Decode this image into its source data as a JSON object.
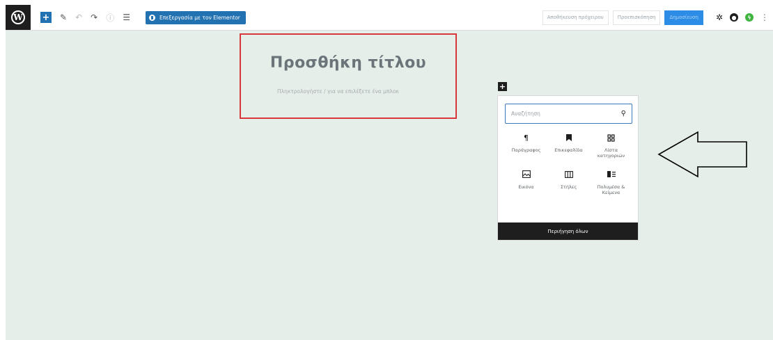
{
  "toolbar": {
    "add_icon": "plus-icon",
    "elementor_button_label": "Επεξεργασία με τον Elementor",
    "save_draft_label": "Αποθήκευση πρόχειρου",
    "preview_label": "Προεπισκόπηση",
    "publish_label": "Δημοσίευση"
  },
  "editor": {
    "title_placeholder": "Προσθήκη τίτλου",
    "block_placeholder": "Πληκτρολογήστε / για να επιλέξετε ένα μπλοκ"
  },
  "inserter": {
    "search_placeholder": "Αναζήτηση",
    "blocks": [
      {
        "label": "Παράγραφος",
        "icon": "paragraph-icon"
      },
      {
        "label": "Επικεφαλίδα",
        "icon": "bookmark-icon"
      },
      {
        "label": "Λίστα κατηγοριών",
        "icon": "grid-icon"
      },
      {
        "label": "Εικόνα",
        "icon": "image-icon"
      },
      {
        "label": "Στήλες",
        "icon": "columns-icon"
      },
      {
        "label": "Πολυμέσα & Κείμενα",
        "icon": "media-text-icon"
      }
    ],
    "browse_all_label": "Περιήγηση όλων"
  },
  "colors": {
    "accent": "#2271b1",
    "highlight_box": "#d9363a",
    "canvas_background": "#e6eeea"
  }
}
